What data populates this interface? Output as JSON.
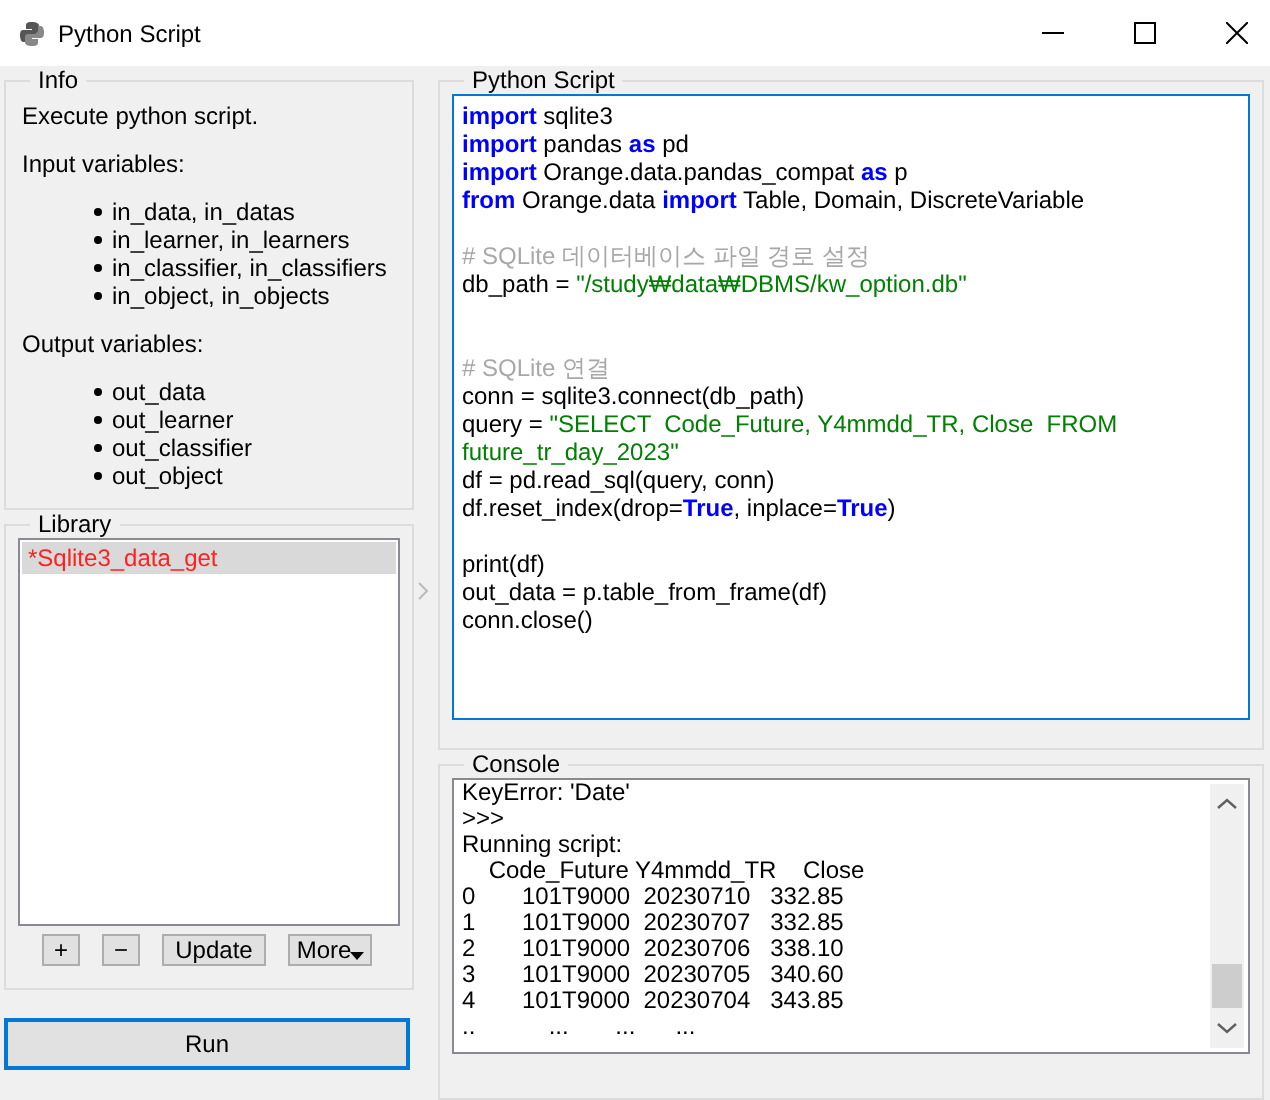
{
  "window": {
    "title": "Python Script"
  },
  "info": {
    "title": "Info",
    "description": "Execute python script.",
    "input_heading": "Input variables:",
    "inputs": [
      "in_data, in_datas",
      "in_learner, in_learners",
      "in_classifier, in_classifiers",
      "in_object, in_objects"
    ],
    "output_heading": "Output variables:",
    "outputs": [
      "out_data",
      "out_learner",
      "out_classifier",
      "out_object"
    ]
  },
  "library": {
    "title": "Library",
    "items": [
      {
        "label": "*Sqlite3_data_get",
        "selected": true,
        "modified": true
      }
    ],
    "buttons": [
      {
        "label": "+",
        "kind": "plain"
      },
      {
        "label": "−",
        "kind": "plain"
      },
      {
        "label": "Update",
        "kind": "plain"
      },
      {
        "label": "More",
        "kind": "menu"
      }
    ]
  },
  "run_button": "Run",
  "script": {
    "title": "Python Script",
    "lines": [
      {
        "kind": "code",
        "segments": [
          {
            "kind": "keyword",
            "text": "import"
          },
          {
            "kind": "plain",
            "text": " sqlite3"
          }
        ]
      },
      {
        "kind": "code",
        "segments": [
          {
            "kind": "keyword",
            "text": "import"
          },
          {
            "kind": "plain",
            "text": " pandas "
          },
          {
            "kind": "keyword",
            "text": "as"
          },
          {
            "kind": "plain",
            "text": " pd"
          }
        ]
      },
      {
        "kind": "code",
        "segments": [
          {
            "kind": "keyword",
            "text": "import"
          },
          {
            "kind": "plain",
            "text": " Orange.data.pandas_compat "
          },
          {
            "kind": "keyword",
            "text": "as"
          },
          {
            "kind": "plain",
            "text": " p"
          }
        ]
      },
      {
        "kind": "code",
        "segments": [
          {
            "kind": "keyword",
            "text": "from"
          },
          {
            "kind": "plain",
            "text": " Orange.data "
          },
          {
            "kind": "keyword",
            "text": "import"
          },
          {
            "kind": "plain",
            "text": " Table, Domain, DiscreteVariable"
          }
        ]
      },
      {
        "kind": "blank"
      },
      {
        "kind": "code",
        "segments": [
          {
            "kind": "comment",
            "text": "# SQLite 데이터베이스 파일 경로 설정"
          }
        ]
      },
      {
        "kind": "code",
        "segments": [
          {
            "kind": "plain",
            "text": "db_path = "
          },
          {
            "kind": "string",
            "text": "\"/study₩data₩DBMS/kw_option.db\""
          }
        ]
      },
      {
        "kind": "blank"
      },
      {
        "kind": "blank"
      },
      {
        "kind": "code",
        "segments": [
          {
            "kind": "comment",
            "text": "# SQLite 연결"
          }
        ]
      },
      {
        "kind": "code",
        "segments": [
          {
            "kind": "plain",
            "text": "conn = sqlite3.connect(db_path)"
          }
        ]
      },
      {
        "kind": "code",
        "segments": [
          {
            "kind": "plain",
            "text": "query = "
          },
          {
            "kind": "string",
            "text": "\"SELECT  Code_Future, Y4mmdd_TR, Close  FROM"
          }
        ]
      },
      {
        "kind": "code",
        "segments": [
          {
            "kind": "string",
            "text": "future_tr_day_2023\""
          }
        ]
      },
      {
        "kind": "code",
        "segments": [
          {
            "kind": "plain",
            "text": "df = pd.read_sql(query, conn)"
          }
        ]
      },
      {
        "kind": "code",
        "segments": [
          {
            "kind": "plain",
            "text": "df.reset_index(drop="
          },
          {
            "kind": "keyword",
            "text": "True"
          },
          {
            "kind": "plain",
            "text": ", inplace="
          },
          {
            "kind": "keyword",
            "text": "True"
          },
          {
            "kind": "plain",
            "text": ")"
          }
        ]
      },
      {
        "kind": "blank"
      },
      {
        "kind": "code",
        "segments": [
          {
            "kind": "plain",
            "text": "print(df)"
          }
        ]
      },
      {
        "kind": "code",
        "segments": [
          {
            "kind": "plain",
            "text": "out_data = p.table_from_frame(df)"
          }
        ]
      },
      {
        "kind": "code",
        "segments": [
          {
            "kind": "plain",
            "text": "conn.close()"
          }
        ]
      }
    ]
  },
  "console": {
    "title": "Console",
    "lines": [
      "KeyError: 'Date'",
      ">>>",
      "Running script:",
      "    Code_Future Y4mmdd_TR    Close",
      "0       101T9000  20230710   332.85",
      "1       101T9000  20230707   332.85",
      "2       101T9000  20230706   338.10",
      "3       101T9000  20230705   340.60",
      "4       101T9000  20230704   343.85",
      "..           ...       ...      ..."
    ]
  }
}
